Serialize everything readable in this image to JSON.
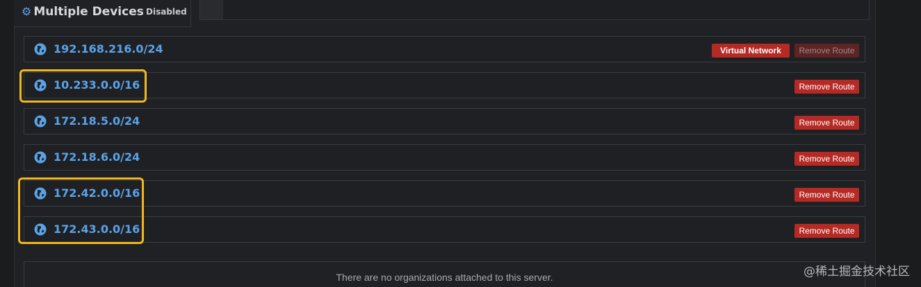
{
  "header": {
    "title": "Multiple Devices",
    "status": "Disabled",
    "icon": "gear-icon"
  },
  "routes": [
    {
      "network": "192.168.216.0/24",
      "virtual_network_label": "Virtual Network",
      "remove_label": "Remove Route",
      "remove_disabled": true
    },
    {
      "network": "10.233.0.0/16",
      "remove_label": "Remove Route"
    },
    {
      "network": "172.18.5.0/24",
      "remove_label": "Remove Route"
    },
    {
      "network": "172.18.6.0/24",
      "remove_label": "Remove Route"
    },
    {
      "network": "172.42.0.0/16",
      "remove_label": "Remove Route"
    },
    {
      "network": "172.43.0.0/16",
      "remove_label": "Remove Route"
    }
  ],
  "organizations": {
    "empty_message": "There are no organizations attached to this server."
  },
  "watermark": "@稀土掘金技术社区",
  "colors": {
    "accent": "#5aa3e8",
    "danger": "#b52a24",
    "highlight": "#f0b820",
    "background": "#1b1c1e"
  }
}
